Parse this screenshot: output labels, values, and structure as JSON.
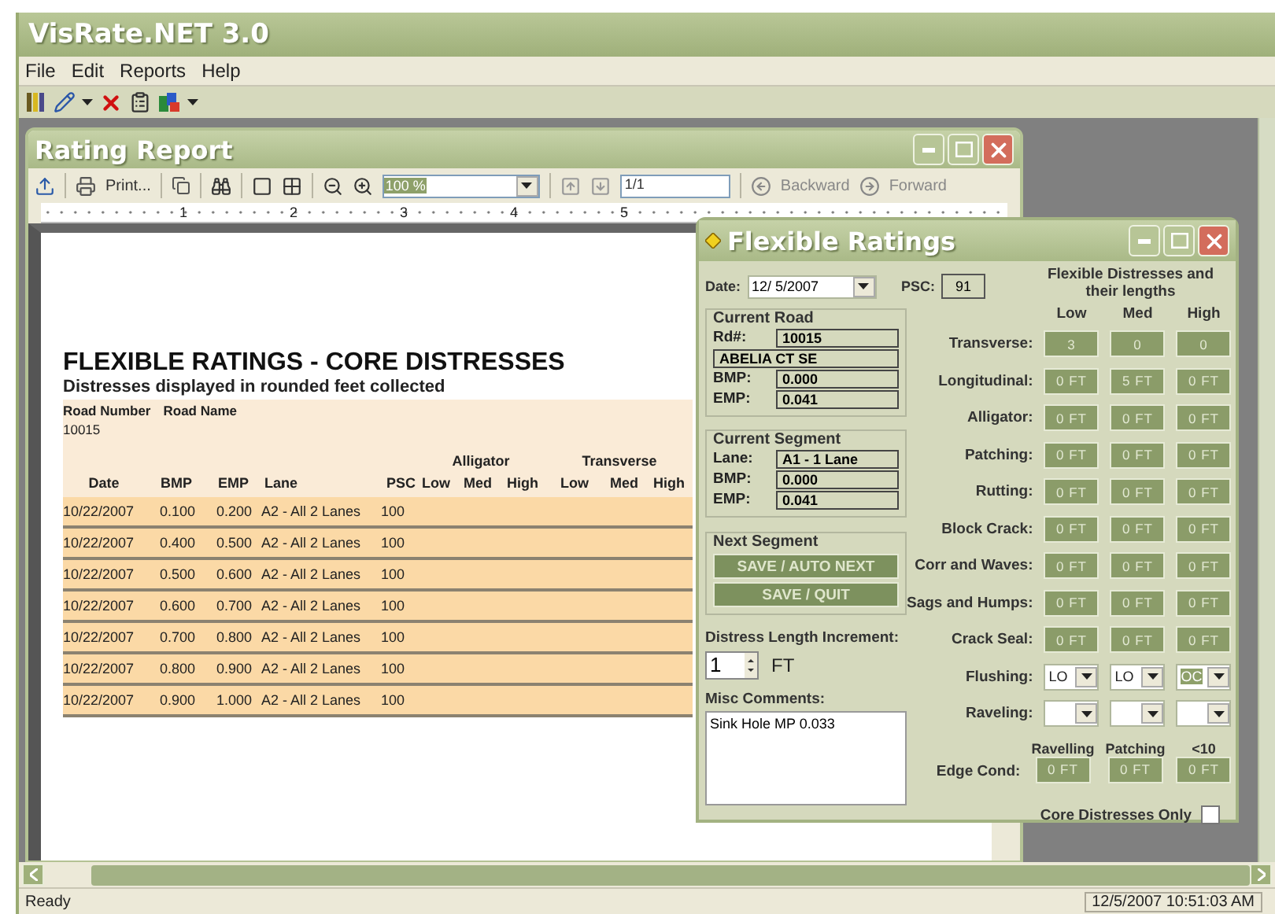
{
  "app": {
    "title": "VisRate.NET 3.0"
  },
  "menu": [
    "File",
    "Edit",
    "Reports",
    "Help"
  ],
  "report_window": {
    "title": "Rating Report",
    "toolbar": {
      "print": "Print...",
      "zoom": "100 %",
      "page": "1/1",
      "backward": "Backward",
      "forward": "Forward"
    },
    "ruler": [
      "1",
      "2",
      "3",
      "4",
      "5"
    ],
    "report": {
      "title": "FLEXIBLE RATINGS - CORE DISTRESSES",
      "subtitle": "Distresses displayed in rounded feet collected",
      "road_columns": [
        "Road Number",
        "Road Name"
      ],
      "road_number": "10015",
      "columns": [
        "Date",
        "BMP",
        "EMP",
        "Lane",
        "PSC"
      ],
      "groups": [
        {
          "label": "Alligator",
          "columns": [
            "Low",
            "Med",
            "High"
          ]
        },
        {
          "label": "Transverse",
          "columns": [
            "Low",
            "Med",
            "High"
          ]
        }
      ],
      "rows": [
        [
          "10/22/2007",
          "0.100",
          "0.200",
          "A2 - All 2 Lanes",
          "100"
        ],
        [
          "10/22/2007",
          "0.400",
          "0.500",
          "A2 - All 2 Lanes",
          "100"
        ],
        [
          "10/22/2007",
          "0.500",
          "0.600",
          "A2 - All 2 Lanes",
          "100"
        ],
        [
          "10/22/2007",
          "0.600",
          "0.700",
          "A2 - All 2 Lanes",
          "100"
        ],
        [
          "10/22/2007",
          "0.700",
          "0.800",
          "A2 - All 2 Lanes",
          "100"
        ],
        [
          "10/22/2007",
          "0.800",
          "0.900",
          "A2 - All 2 Lanes",
          "100"
        ],
        [
          "10/22/2007",
          "0.900",
          "1.000",
          "A2 - All 2 Lanes",
          "100"
        ]
      ]
    }
  },
  "ratings_window": {
    "title": "Flexible Ratings",
    "date": {
      "label": "Date:",
      "value": "12/ 5/2007"
    },
    "psc": {
      "label": "PSC:",
      "value": "91"
    },
    "current_road": {
      "legend": "Current Road",
      "fields": [
        {
          "label": "Rd#:",
          "value": "10015"
        },
        {
          "value": "ABELIA CT SE"
        },
        {
          "label": "BMP:",
          "value": "0.000"
        },
        {
          "label": "EMP:",
          "value": "0.041"
        }
      ]
    },
    "current_segment": {
      "legend": "Current Segment",
      "fields": [
        {
          "label": "Lane:",
          "value": "A1 - 1 Lane"
        },
        {
          "label": "BMP:",
          "value": "0.000"
        },
        {
          "label": "EMP:",
          "value": "0.041"
        }
      ]
    },
    "next_segment": {
      "legend": "Next Segment",
      "buttons": [
        "SAVE / AUTO NEXT",
        "SAVE / QUIT"
      ]
    },
    "increment": {
      "label": "Distress Length Increment:",
      "value": "1",
      "unit": "FT"
    },
    "comments": {
      "label": "Misc Comments:",
      "value": "Sink Hole MP 0.033"
    },
    "distresses": {
      "header": "Flexible Distresses and their lengths",
      "columns": [
        "Low",
        "Med",
        "High"
      ],
      "rows": [
        {
          "label": "Transverse:",
          "kind": "cells",
          "cells": [
            {
              "text": "3"
            },
            {
              "text": "0"
            },
            {
              "text": "0"
            }
          ]
        },
        {
          "label": "Longitudinal:",
          "kind": "cells",
          "cells": [
            {
              "text": "0 FT"
            },
            {
              "text": "5 FT"
            },
            {
              "text": "0 FT"
            }
          ]
        },
        {
          "label": "Alligator:",
          "kind": "cells",
          "cells": [
            {
              "text": "0 FT"
            },
            {
              "text": "0 FT"
            },
            {
              "text": "0 FT"
            }
          ]
        },
        {
          "label": "Patching:",
          "kind": "cells",
          "cells": [
            {
              "text": "0 FT"
            },
            {
              "text": "0 FT"
            },
            {
              "text": "0 FT"
            }
          ]
        },
        {
          "label": "Rutting:",
          "kind": "cells",
          "cells": [
            {
              "text": "0 FT"
            },
            {
              "text": "0 FT"
            },
            {
              "text": "0 FT"
            }
          ]
        },
        {
          "label": "Block Crack:",
          "kind": "cells",
          "cells": [
            {
              "text": "0 FT"
            },
            {
              "text": "0 FT"
            },
            {
              "text": "0 FT"
            }
          ]
        },
        {
          "label": "Corr and Waves:",
          "kind": "cells",
          "cells": [
            {
              "text": "0 FT"
            },
            {
              "text": "0 FT"
            },
            {
              "text": "0 FT"
            }
          ]
        },
        {
          "label": "Sags and Humps:",
          "kind": "cells",
          "cells": [
            {
              "text": "0 FT"
            },
            {
              "text": "0 FT"
            },
            {
              "text": "0 FT"
            }
          ]
        },
        {
          "label": "Crack Seal:",
          "kind": "cells",
          "cells": [
            {
              "text": "0 FT"
            },
            {
              "text": "0 FT"
            },
            {
              "text": "0 FT"
            }
          ]
        },
        {
          "label": "Flushing:",
          "kind": "combo",
          "cells": [
            {
              "text": "LO",
              "highlighted": false
            },
            {
              "text": "LO",
              "highlighted": false
            },
            {
              "text": "OC",
              "highlighted": true
            }
          ]
        },
        {
          "label": "Raveling:",
          "kind": "combo",
          "cells": [
            {},
            {},
            {}
          ]
        },
        {
          "label": "Edge Cond:",
          "kind": "edge",
          "cells": [
            {
              "caption": "Ravelling",
              "text": "0 FT"
            },
            {
              "caption": "Patching",
              "text": "0 FT"
            },
            {
              "caption": "<10",
              "text": "0 FT"
            }
          ]
        }
      ]
    },
    "core_only": {
      "label": "Core Distresses Only",
      "checked": false
    }
  },
  "status_bar": {
    "text": "Ready",
    "time": "12/5/2007 10:51:03 AM"
  }
}
